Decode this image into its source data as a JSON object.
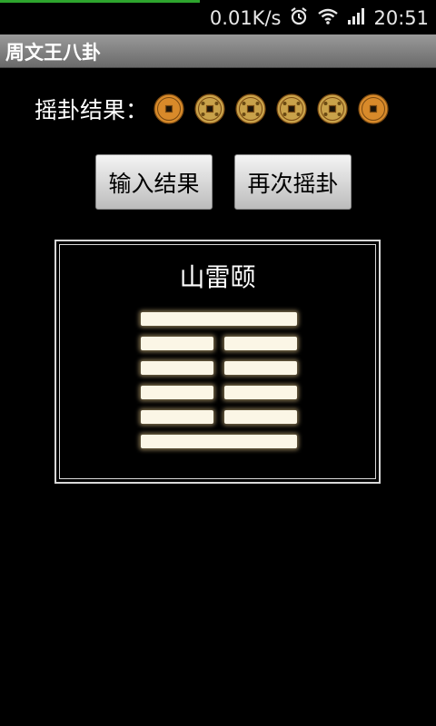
{
  "status_bar": {
    "net_speed": "0.01K/s",
    "time": "20:51",
    "icons": [
      "alarm-icon",
      "wifi-icon",
      "signal-icon"
    ]
  },
  "app": {
    "title": "周文王八卦"
  },
  "result": {
    "label": "摇卦结果：",
    "coins": [
      "coin-front",
      "coin-back",
      "coin-back",
      "coin-back",
      "coin-back",
      "coin-front"
    ]
  },
  "buttons": {
    "input_result": "输入结果",
    "reshake": "再次摇卦"
  },
  "hexagram": {
    "name": "山雷颐",
    "lines": [
      "yang",
      "yin",
      "yin",
      "yin",
      "yin",
      "yang"
    ]
  },
  "colors": {
    "line": "#fbf6e6",
    "coin_front": "#d88a2a",
    "coin_back": "#c9a24a"
  }
}
